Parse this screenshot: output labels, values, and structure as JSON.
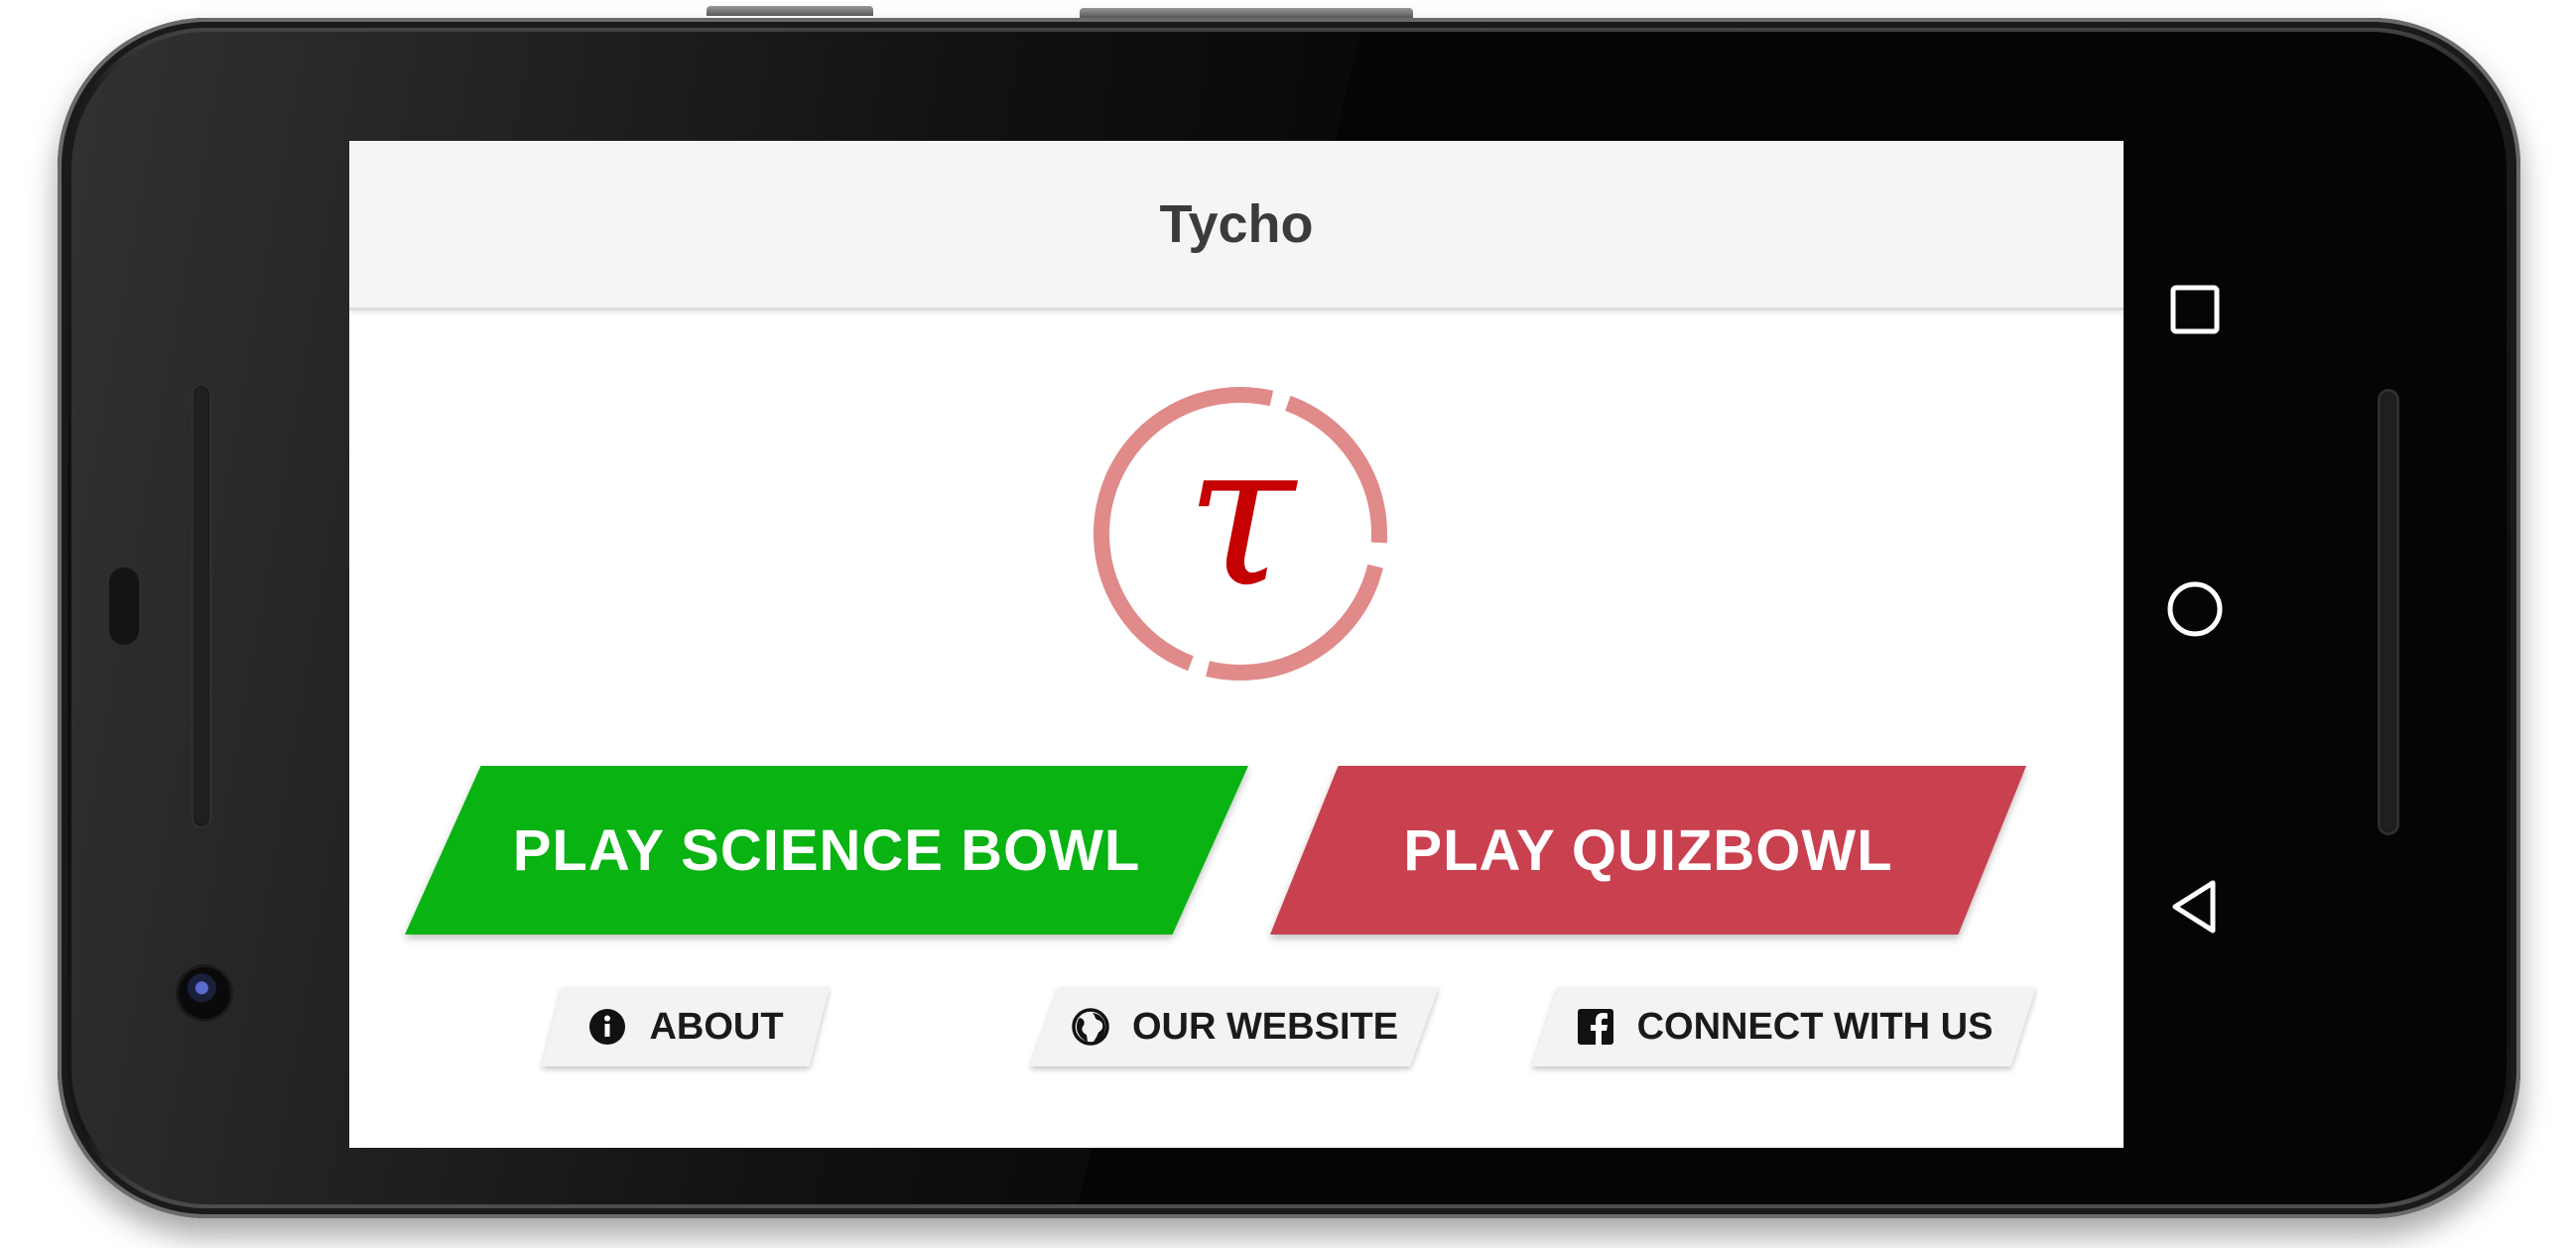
{
  "app": {
    "title": "Tycho",
    "logo_glyph": "τ"
  },
  "main": {
    "primary_buttons": [
      {
        "label": "PLAY SCIENCE BOWL",
        "color": "#08b312"
      },
      {
        "label": "PLAY QUIZBOWL",
        "color": "#c9404f"
      }
    ],
    "secondary_buttons": [
      {
        "label": "ABOUT",
        "icon": "info-icon"
      },
      {
        "label": "OUR WEBSITE",
        "icon": "globe-icon"
      },
      {
        "label": "CONNECT WITH US",
        "icon": "facebook-icon"
      }
    ]
  },
  "navbar": {
    "items": [
      {
        "icon": "recents-square-icon"
      },
      {
        "icon": "home-circle-icon"
      },
      {
        "icon": "back-triangle-icon"
      }
    ]
  },
  "colors": {
    "logo_ring": "#e08a8a",
    "logo_tau": "#c40000",
    "appbar_bg": "#f5f5f5"
  }
}
